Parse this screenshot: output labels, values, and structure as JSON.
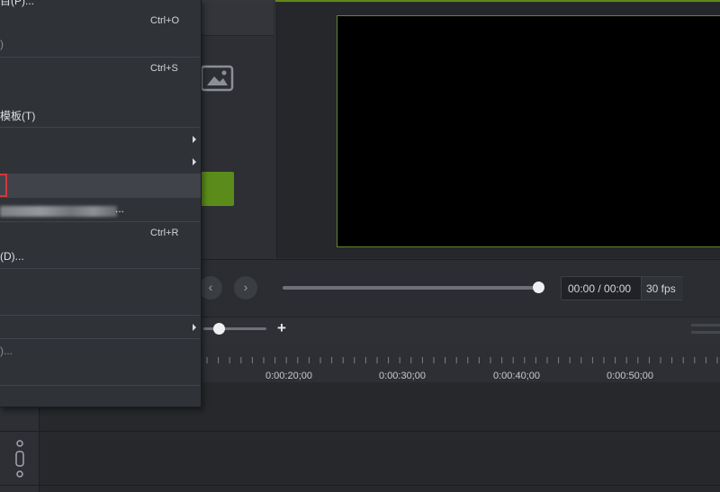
{
  "file_menu": {
    "items": [
      {
        "label": "目(P)...",
        "shortcut": ""
      },
      {
        "label": "",
        "shortcut": "Ctrl+O"
      },
      {
        "label": ")",
        "shortcut": ""
      },
      {
        "label": "",
        "shortcut": "Ctrl+S"
      },
      {
        "label": "模板(T)",
        "shortcut": ""
      },
      {
        "label": "...",
        "shortcut": ""
      },
      {
        "label": "",
        "shortcut": "Ctrl+R"
      },
      {
        "label": "(D)...",
        "shortcut": ""
      },
      {
        "label": ")...",
        "shortcut": ""
      }
    ]
  },
  "playback": {
    "timecode": "00:00 / 00:00",
    "fps": "30 fps",
    "prev_icon": "‹",
    "next_icon": "›"
  },
  "zoom": {
    "plus_label": "+"
  },
  "timeline": {
    "tick_labels": [
      "0:00:20;00",
      "0:00:30;00",
      "0:00:40;00",
      "0:00:50;00"
    ]
  },
  "colors": {
    "accent_green": "#5b8c1b",
    "highlight_red": "#d4373c"
  },
  "icons": {
    "media_icon": "image-icon",
    "track_handle": "drag-handle-icon"
  }
}
